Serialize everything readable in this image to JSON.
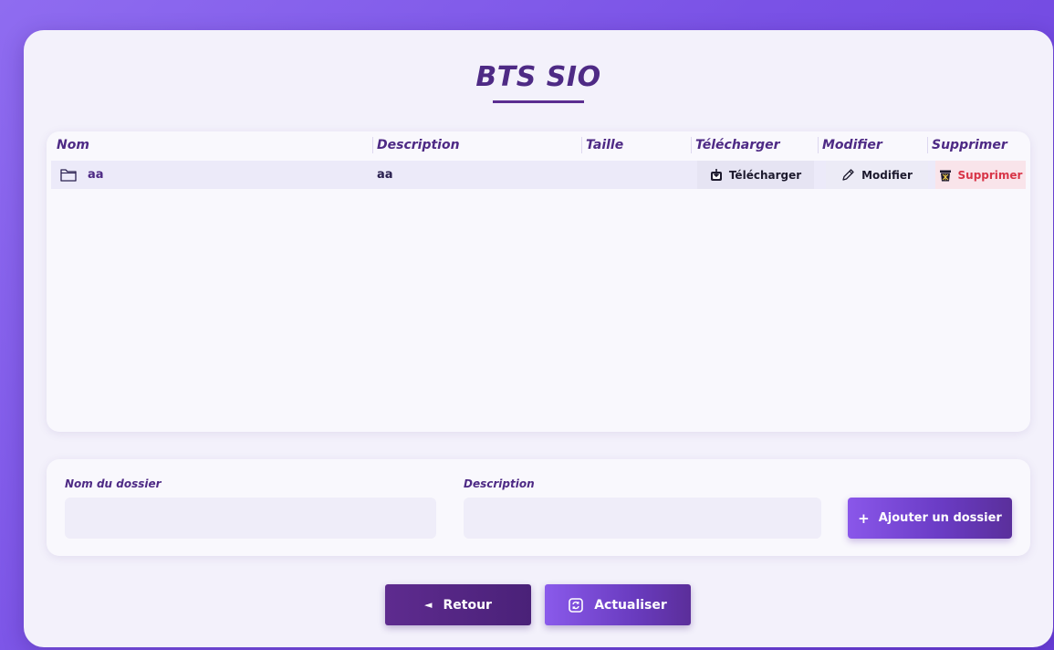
{
  "page": {
    "title": "BTS SIO"
  },
  "table": {
    "headers": {
      "name": "Nom",
      "description": "Description",
      "size": "Taille",
      "download": "Télécharger",
      "edit": "Modifier",
      "delete": "Supprimer"
    },
    "rows": [
      {
        "name": "aa",
        "description": "aa",
        "size": "",
        "download_label": "Télécharger",
        "edit_label": "Modifier",
        "delete_label": "Supprimer",
        "icon": "folder-icon"
      }
    ]
  },
  "form": {
    "folder_name_label": "Nom du dossier",
    "folder_name_value": "",
    "description_label": "Description",
    "description_value": "",
    "add_button_icon": "+",
    "add_button_label": "Ajouter un dossier"
  },
  "footer": {
    "back_icon": "◄",
    "back_label": "Retour",
    "refresh_label": "Actualiser"
  },
  "colors": {
    "accent": "#4e2a85",
    "background": "#7a52e6",
    "delete": "#d83548"
  }
}
